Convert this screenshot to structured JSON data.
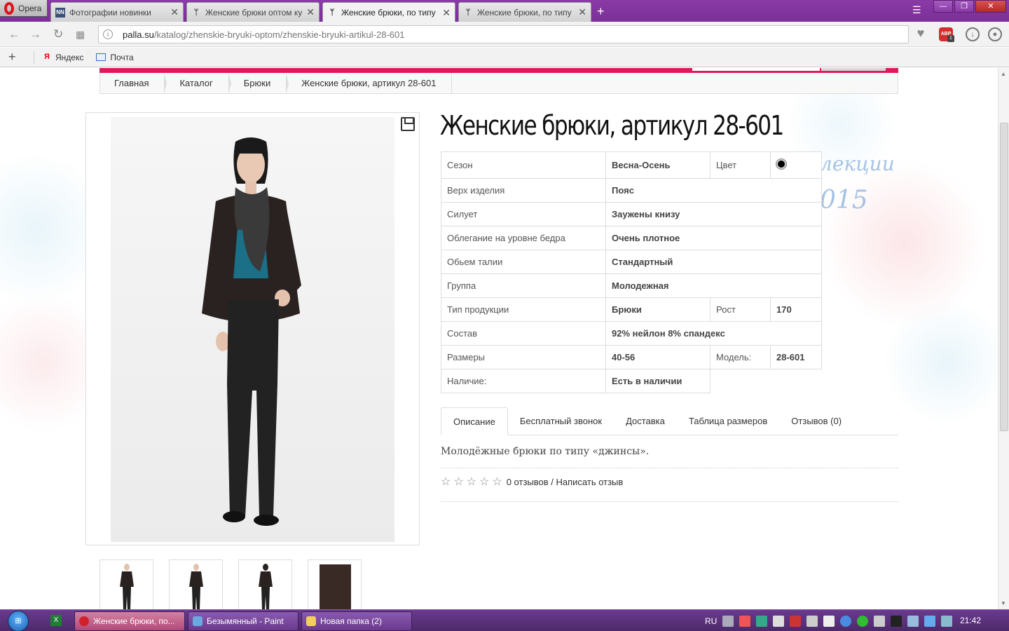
{
  "browser": {
    "opera_label": "Opera",
    "tabs": [
      {
        "title": "Фотографии новинки",
        "favicon": "NN"
      },
      {
        "title": "Женские брюки оптом ку",
        "favicon": "dress"
      },
      {
        "title": "Женские брюки, по типу",
        "favicon": "dress"
      },
      {
        "title": "Женские брюки, по типу",
        "favicon": "dress"
      }
    ],
    "url_domain": "palla.su",
    "url_path": "/katalog/zhenskie-bryuki-optom/zhenskie-bryuki-artikul-28-601",
    "abp_label": "ABP",
    "abp_count": "1",
    "bookmarks": [
      {
        "label": "Яндекс",
        "icon": "yandex-icon"
      },
      {
        "label": "Почта",
        "icon": "mail-icon"
      }
    ]
  },
  "page": {
    "breadcrumb": [
      "Главная",
      "Каталог",
      "Брюки",
      "Женские брюки, артикул 28-601"
    ],
    "title": "Женские брюки, артикул 28-601",
    "specs": {
      "season_label": "Сезон",
      "season_value": "Весна-Осень",
      "color_label": "Цвет",
      "color_value": "#000000",
      "top_label": "Верх изделия",
      "top_value": "Пояс",
      "silhouette_label": "Силует",
      "silhouette_value": "Заужены книзу",
      "fit_label": "Облегание на уровне бедра",
      "fit_value": "Очень плотное",
      "waist_label": "Обьем талии",
      "waist_value": "Стандартный",
      "group_label": "Группа",
      "group_value": "Молодежная",
      "type_label": "Тип продукции",
      "type_value": "Брюки",
      "height_label": "Рост",
      "height_value": "170",
      "composition_label": "Состав",
      "composition_value": "92% нейлон 8% спандекс",
      "sizes_label": "Размеры",
      "sizes_value": "40-56",
      "model_label": "Модель:",
      "model_value": "28-601",
      "availability_label": "Наличие:",
      "availability_value": "Есть в наличии"
    },
    "tabs": [
      "Описание",
      "Бесплатный звонок",
      "Доставка",
      "Таблица размеров",
      "Отзывов (0)"
    ],
    "description": "Молодёжные брюки по типу «джинсы».",
    "reviews_text": "0 отзывов / Написать отзыв",
    "rating": 0,
    "overlay_line1": "лекции",
    "overlay_line2": "015"
  },
  "taskbar": {
    "start_label": "Start",
    "windows": [
      "Женские брюки, по...",
      "Безымянный - Paint",
      "Новая папка (2)"
    ],
    "language": "RU",
    "clock": "21:42"
  }
}
